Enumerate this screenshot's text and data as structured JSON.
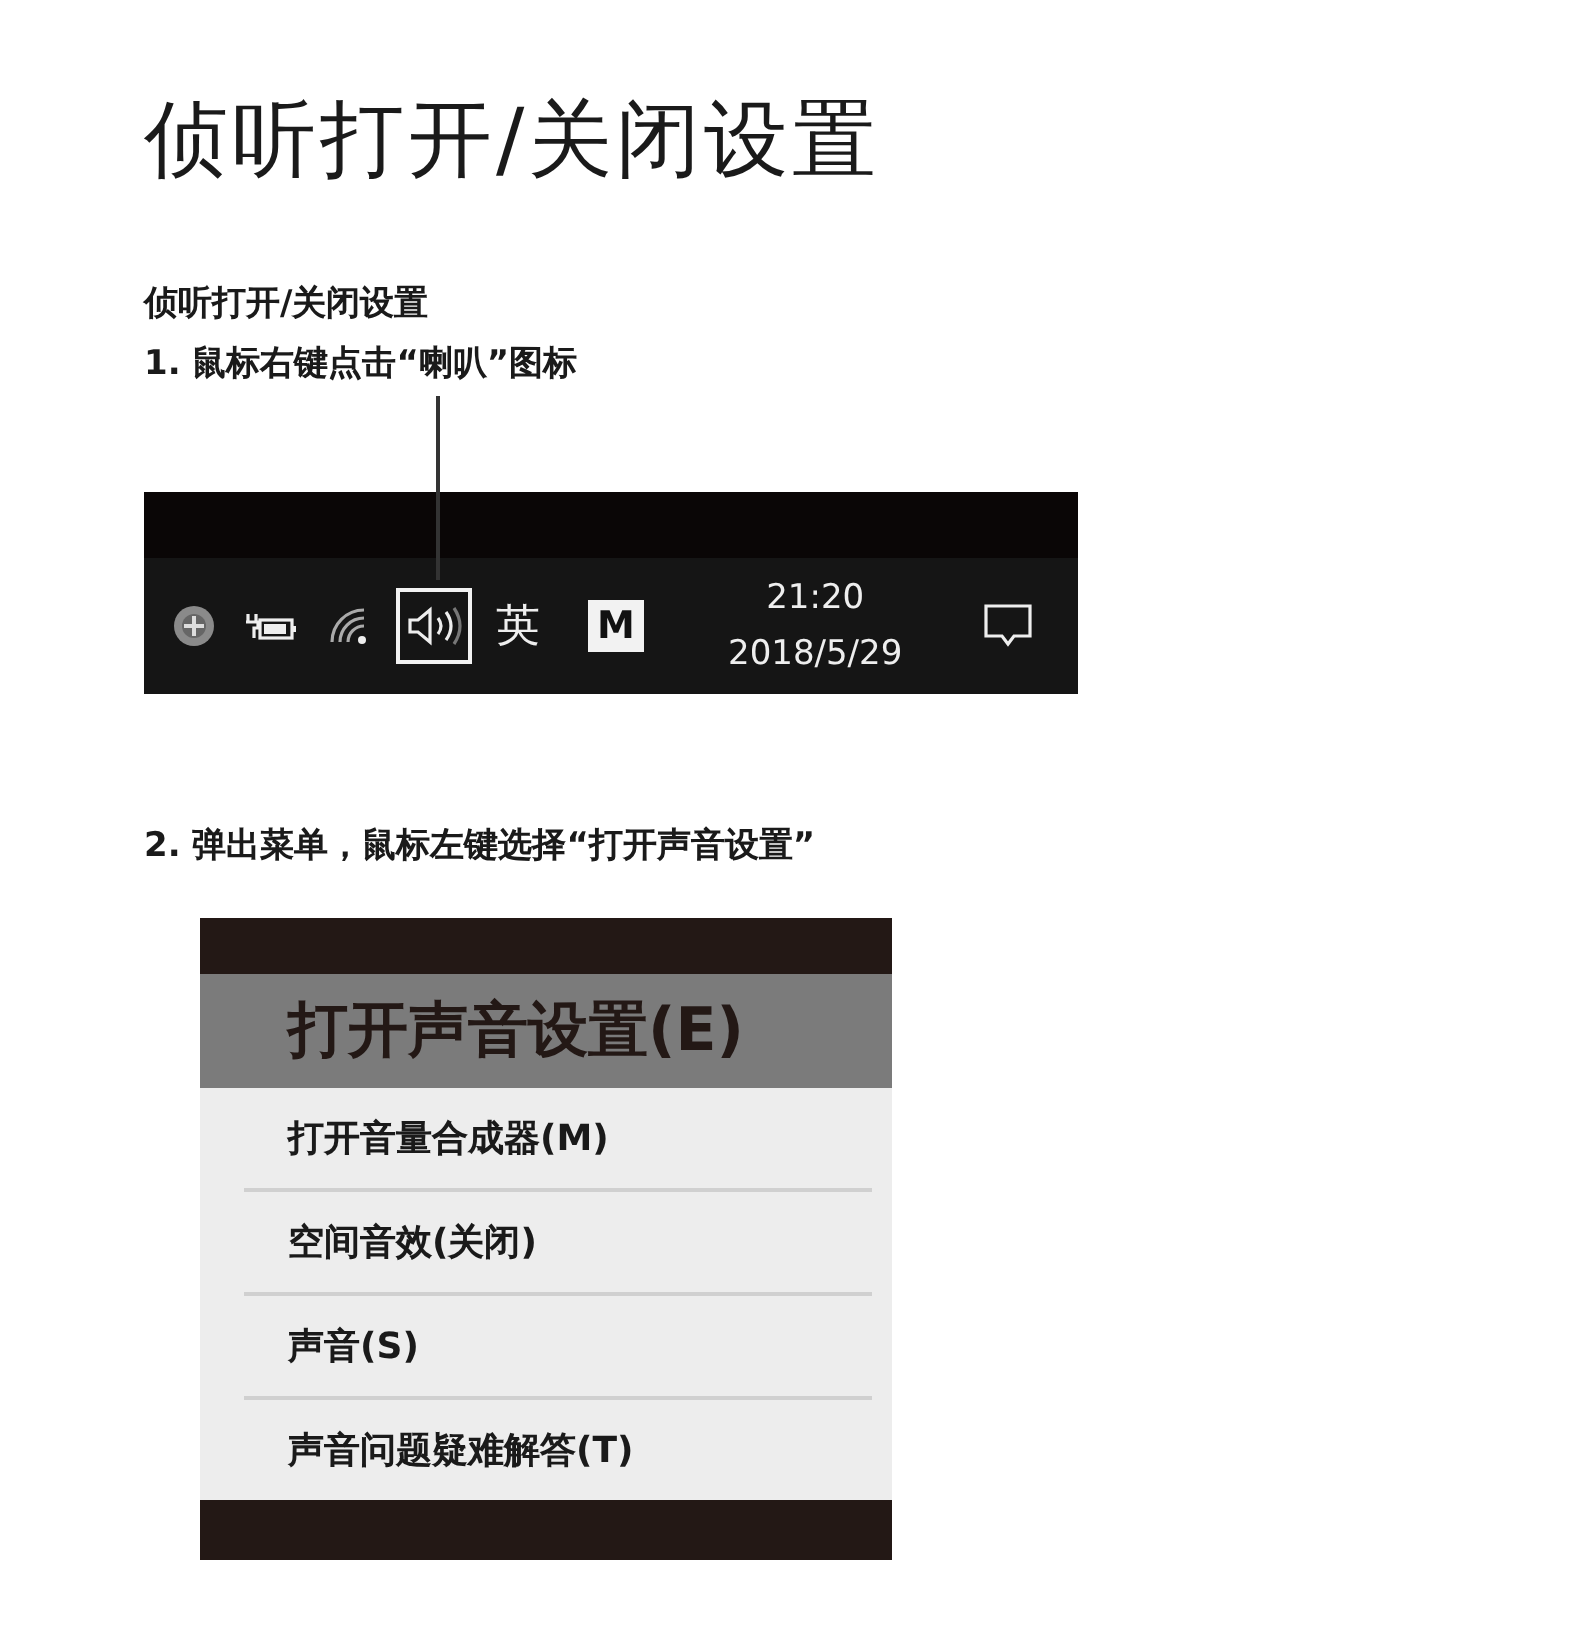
{
  "title": "侦听打开/关闭设置",
  "subtitle": "侦听打开/关闭设置",
  "step1": "1. 鼠标右键点击“喇叭”图标",
  "tray": [
    {
      "kind": "globe",
      "highlighted": false
    },
    {
      "kind": "power",
      "highlighted": false
    },
    {
      "kind": "wifi",
      "highlighted": false
    },
    {
      "kind": "speaker",
      "highlighted": true
    },
    {
      "kind": "text",
      "text": "英",
      "highlighted": false
    },
    {
      "kind": "ime",
      "text": "M",
      "highlighted": false
    },
    {
      "kind": "clock",
      "time": "21:20",
      "date": "2018/5/29",
      "highlighted": false
    },
    {
      "kind": "notification",
      "highlighted": false
    }
  ],
  "step2": "2. 弹出菜单，鼠标左键选择“打开声音设置”",
  "menu": [
    {
      "label": "打开声音设置(E)",
      "selected": true
    },
    {
      "label": "打开音量合成器(M)",
      "selected": false
    },
    {
      "label": "空间音效(关闭)",
      "selected": false
    },
    {
      "label": "声音(S)",
      "selected": false
    },
    {
      "label": "声音问题疑难解答(T)",
      "selected": false
    }
  ]
}
